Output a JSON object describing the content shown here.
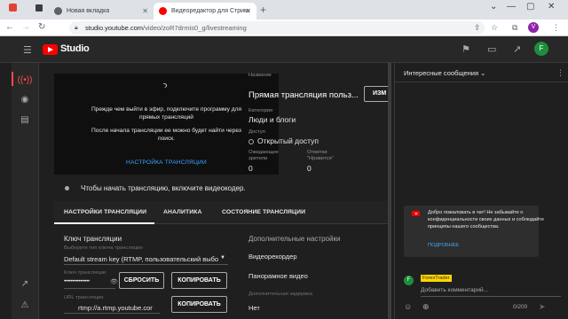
{
  "browser": {
    "tabs": [
      {
        "title": "Новая вкладка",
        "active": false
      },
      {
        "title": "Видеоредактор для Стрима на You",
        "active": true
      }
    ],
    "url_host": "studio.youtube.com",
    "url_path": "/video/zoR7drmis0_g/livestreaming",
    "profile_letter": "V"
  },
  "studio": {
    "logo_text": "Studio",
    "account_letter": "F"
  },
  "preview": {
    "line1": "Прежде чем выйти в эфир, подключите программу для",
    "line2": "прямых трансляций",
    "line3": "После начала трансляции ее можно будет найти через",
    "line4": "поиск.",
    "setup_link": "НАСТРОЙКА ТРАНСЛЯЦИИ"
  },
  "meta": {
    "title_label": "Название",
    "title_value": "Прямая трансляция польз...",
    "edit_button": "ИЗМ",
    "category_label": "Категория",
    "category_value": "Люди и блоги",
    "access_label": "Доступ",
    "access_value": "Открытый доступ",
    "viewers_label1": "Ожидающие",
    "viewers_label2": "зрители",
    "viewers_value": "0",
    "likes_label1": "Отметки",
    "likes_label2": "\"Нравится\"",
    "likes_value": "0"
  },
  "status_text": "Чтобы начать трансляцию, включите видеокодер.",
  "stream_tabs": [
    "НАСТРОЙКИ ТРАНСЛЯЦИИ",
    "АНАЛИТИКА",
    "СОСТОЯНИЕ ТРАНСЛЯЦИИ"
  ],
  "settings": {
    "key_section": "Ключ трансляции",
    "select_label": "Выберите тип ключа трансляции",
    "select_value": "Default stream key (RTMP, пользовательский выбо",
    "key_label": "Ключ трансляции",
    "key_value": "••••••••••••••••",
    "reset_button": "СБРОСИТЬ",
    "copy_button": "КОПИРОВАТЬ",
    "url_label": "URL трансляции",
    "url_value": "rtmp://a.rtmp.youtube.cor",
    "copy_button2": "КОПИРОВАТЬ",
    "extra_section": "Дополнительные настройки",
    "opt1": "Видеорекордер",
    "opt2": "Панорамное видео",
    "delay_label": "Дополнительная задержка",
    "delay_value": "Нет"
  },
  "chat": {
    "title": "Интересные сообщения",
    "welcome_text": "Добро пожаловать в чат! Не забывайте о конфиденциальности своих данных и соблюдайте принципы нашего сообщества.",
    "welcome_link": "ПОДРОБНЕЕ",
    "user_name": "ForexTrader",
    "input_placeholder": "Добавить комментарий...",
    "counter": "0/200"
  },
  "colors": {
    "accent_red": "#ff0000",
    "link_blue": "#3ea6ff",
    "chat_name_bg": "#ffd600"
  }
}
